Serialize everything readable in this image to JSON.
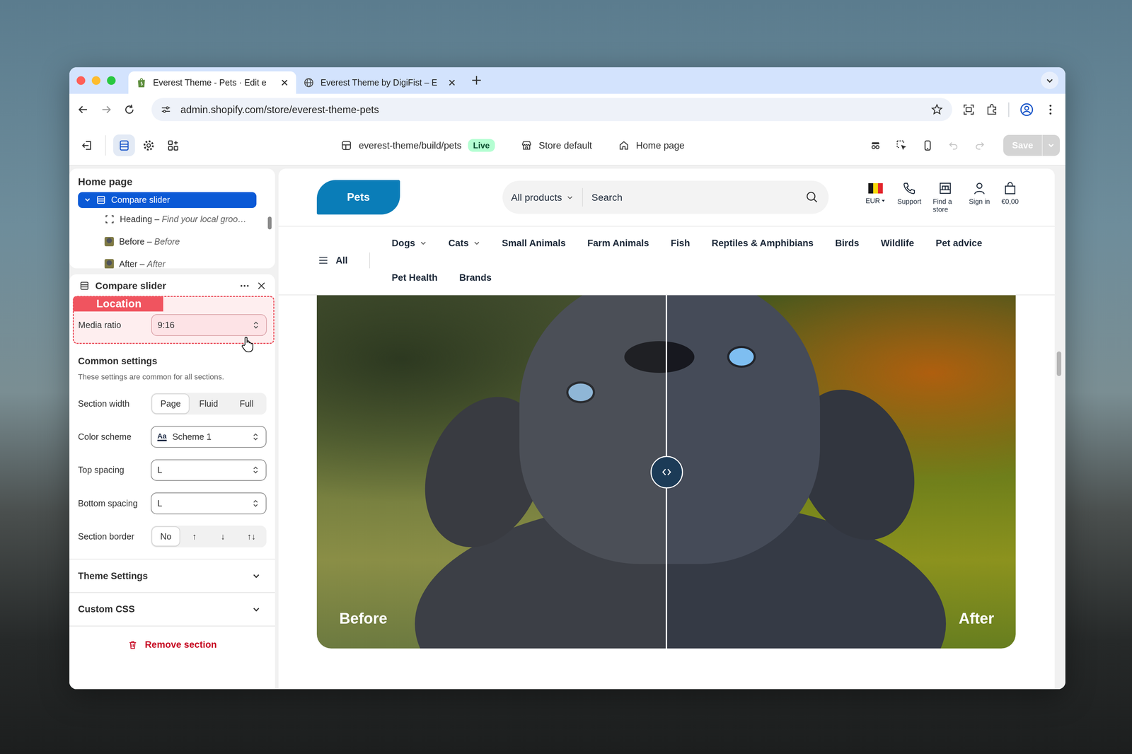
{
  "browser": {
    "tabs": [
      {
        "title": "Everest Theme - Pets · Edit e",
        "selected": true,
        "kind": "shopify"
      },
      {
        "title": "Everest Theme by DigiFist – E",
        "selected": false,
        "kind": "globe"
      }
    ],
    "url": "admin.shopify.com/store/everest-theme-pets"
  },
  "editor_toolbar": {
    "tools": [
      {
        "kind": "sections",
        "selected": true
      },
      {
        "kind": "settings",
        "selected": false
      },
      {
        "kind": "apps",
        "selected": false
      }
    ],
    "theme": "everest-theme/build/pets",
    "badge": "Live",
    "locale": "Store default",
    "page": "Home page",
    "undo_disabled": true,
    "redo_disabled": true,
    "save": {
      "label": "Save",
      "disabled": true
    }
  },
  "sidebar": {
    "title": "Home page",
    "separator": "–",
    "tree": [
      {
        "label": "Compare slider",
        "selected": true,
        "expanded": true,
        "children": [
          {
            "label": "Heading",
            "detail": "Find your local groo…",
            "kind": "text"
          },
          {
            "label": "Before",
            "detail": "Before",
            "kind": "image"
          },
          {
            "label": "After",
            "detail": "After",
            "kind": "image"
          }
        ]
      }
    ]
  },
  "settings": {
    "title": "Compare slider",
    "highlight": "Location",
    "fields": [
      {
        "label": "Media ratio",
        "kind": "select",
        "value": "9:16"
      }
    ],
    "group_title": "Common settings",
    "group_note": "These settings are common for all sections.",
    "common": [
      {
        "label": "Section width",
        "kind": "segmented",
        "options": [
          {
            "label": "Page",
            "selected": true
          },
          {
            "label": "Fluid",
            "selected": false
          },
          {
            "label": "Full",
            "selected": false
          }
        ]
      },
      {
        "label": "Color scheme",
        "kind": "select",
        "value": "Scheme 1",
        "swatch": "Aa"
      },
      {
        "label": "Top spacing",
        "kind": "select",
        "value": "L"
      },
      {
        "label": "Bottom spacing",
        "kind": "select",
        "value": "L"
      },
      {
        "label": "Section border",
        "kind": "segmented",
        "options": [
          {
            "label": "No",
            "selected": true
          },
          {
            "label": "↑",
            "selected": false
          },
          {
            "label": "↓",
            "selected": false
          },
          {
            "label": "↑↓",
            "selected": false
          }
        ]
      }
    ],
    "collapsibles": [
      {
        "label": "Theme Settings",
        "expanded": false
      },
      {
        "label": "Custom CSS",
        "expanded": false
      }
    ],
    "remove": "Remove section"
  },
  "preview": {
    "logo": "Pets",
    "category": "All products",
    "search_placeholder": "Search",
    "header_actions": [
      {
        "label": "EUR",
        "kind": "currency"
      },
      {
        "label": "Support",
        "kind": "phone"
      },
      {
        "label": "Find a store",
        "kind": "store"
      },
      {
        "label": "Sign in",
        "kind": "account"
      },
      {
        "label": "€0,00",
        "kind": "cart"
      }
    ],
    "all_label": "All",
    "nav": [
      {
        "label": "Dogs",
        "dropdown": true
      },
      {
        "label": "Cats",
        "dropdown": true
      },
      {
        "label": "Small Animals",
        "dropdown": false
      },
      {
        "label": "Farm Animals",
        "dropdown": false
      },
      {
        "label": "Fish",
        "dropdown": false
      },
      {
        "label": "Reptiles & Amphibians",
        "dropdown": false
      },
      {
        "label": "Birds",
        "dropdown": false
      },
      {
        "label": "Wildlife",
        "dropdown": false
      },
      {
        "label": "Pet advice",
        "dropdown": false
      },
      {
        "label": "Pet Health",
        "dropdown": false
      },
      {
        "label": "Brands",
        "dropdown": false
      }
    ],
    "compare": {
      "before": "Before",
      "after": "After",
      "level": 0.5
    }
  }
}
